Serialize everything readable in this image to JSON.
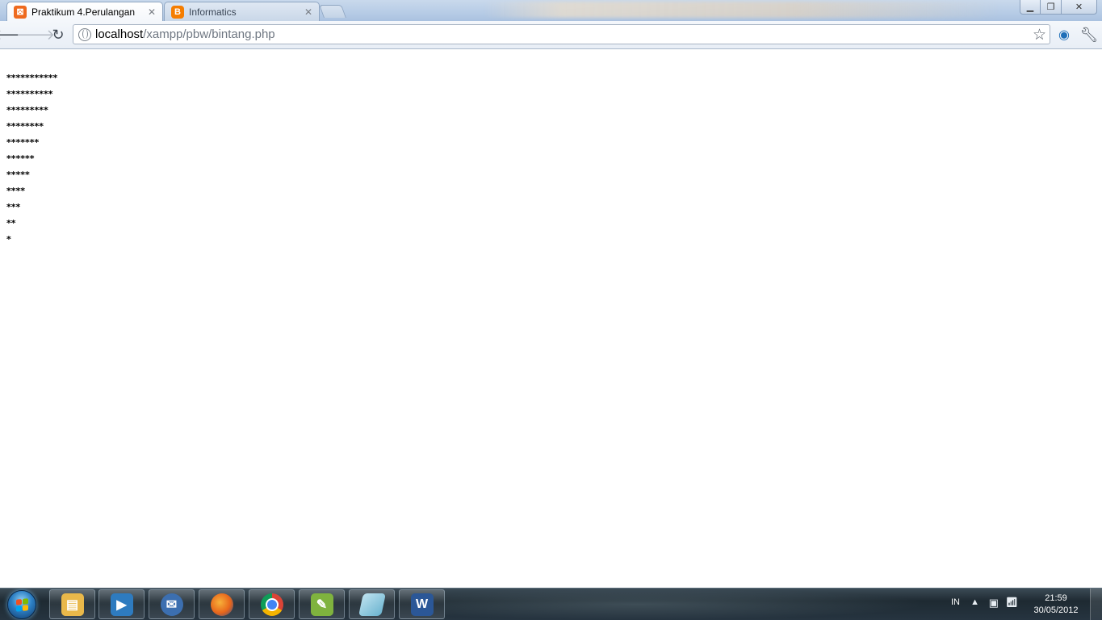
{
  "browser": {
    "tabs": [
      {
        "title": "Praktikum 4.Perulangan",
        "active": true,
        "favicon": "xampp-icon"
      },
      {
        "title": "Informatics",
        "active": false,
        "favicon": "blogger-icon"
      }
    ],
    "address": {
      "host": "localhost",
      "path": "/xampp/pbw/bintang.php"
    }
  },
  "content": {
    "star_rows": [
      "***********",
      "**********",
      "*********",
      "********",
      "*******",
      "******",
      "*****",
      "****",
      "***",
      "**",
      "*"
    ]
  },
  "taskbar": {
    "apps": [
      {
        "name": "windows-explorer-icon",
        "color": "#e9b84a"
      },
      {
        "name": "media-player-icon",
        "color": "#2e7bbf"
      },
      {
        "name": "thunderbird-icon",
        "color": "#3c6fb0"
      },
      {
        "name": "firefox-icon",
        "color": "#e8661b"
      },
      {
        "name": "chrome-icon",
        "color": "#2a9d4b"
      },
      {
        "name": "notepad-plus-plus-icon",
        "color": "#7fb33e"
      },
      {
        "name": "generic-app-icon",
        "color": "#6ab3cf"
      },
      {
        "name": "word-icon",
        "color": "#2b5797"
      }
    ],
    "tray": {
      "language": "IN",
      "time": "21:59",
      "date": "30/05/2012"
    }
  }
}
